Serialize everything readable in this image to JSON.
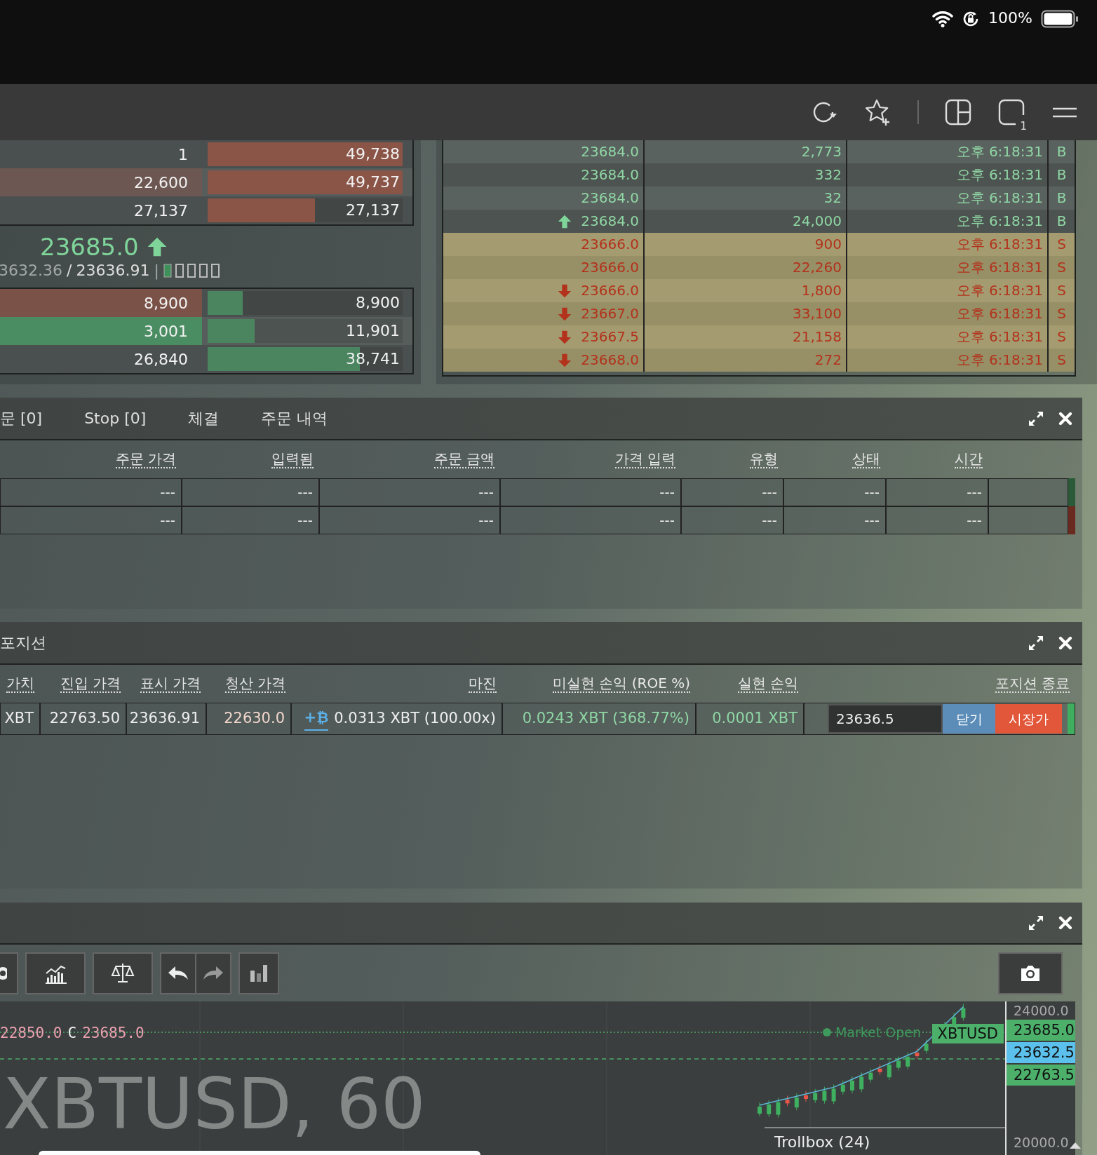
{
  "status_bar": {
    "battery": "100%"
  },
  "browser_toolbar": {
    "tab_count": "1"
  },
  "order_book": {
    "asks": [
      {
        "size": "1",
        "total": "49,738",
        "color": "#4a504f",
        "level": 1
      },
      {
        "size": "22,600",
        "total": "49,737",
        "color": "#6c5753",
        "level": 1
      },
      {
        "size": "27,137",
        "total": "27,137",
        "color": "#4a504f",
        "level": 0.55
      }
    ],
    "last_price": "23685.0",
    "price_rising": true,
    "index_price": "3632.36",
    "separator": "/",
    "mark_price": "23636.91",
    "divider": "|",
    "bids": [
      {
        "size": "8,900",
        "total": "8,900",
        "color": "#7b5248",
        "level": 0.18
      },
      {
        "size": "3,001",
        "total": "11,901",
        "color": "#4b8d63",
        "level": 0.24
      },
      {
        "size": "26,840",
        "total": "38,741",
        "color": "#4a504f",
        "level": 0.78
      }
    ]
  },
  "trades": {
    "rows": [
      {
        "arrow": false,
        "price": "23684.0",
        "size": "2,773",
        "time": "오후 6:18:31",
        "side": "B",
        "kind": "buy"
      },
      {
        "arrow": false,
        "price": "23684.0",
        "size": "332",
        "time": "오후 6:18:31",
        "side": "B",
        "kind": "buy"
      },
      {
        "arrow": false,
        "price": "23684.0",
        "size": "32",
        "time": "오후 6:18:31",
        "side": "B",
        "kind": "buy"
      },
      {
        "arrow": true,
        "price": "23684.0",
        "size": "24,000",
        "time": "오후 6:18:31",
        "side": "B",
        "kind": "buy"
      },
      {
        "arrow": false,
        "price": "23666.0",
        "size": "900",
        "time": "오후 6:18:31",
        "side": "S",
        "kind": "sell"
      },
      {
        "arrow": false,
        "price": "23666.0",
        "size": "22,260",
        "time": "오후 6:18:31",
        "side": "S",
        "kind": "sell"
      },
      {
        "arrow": true,
        "price": "23666.0",
        "size": "1,800",
        "time": "오후 6:18:31",
        "side": "S",
        "kind": "sell"
      },
      {
        "arrow": true,
        "price": "23667.0",
        "size": "33,100",
        "time": "오후 6:18:31",
        "side": "S",
        "kind": "sell"
      },
      {
        "arrow": true,
        "price": "23667.5",
        "size": "21,158",
        "time": "오후 6:18:31",
        "side": "S",
        "kind": "sell"
      },
      {
        "arrow": true,
        "price": "23668.0",
        "size": "272",
        "time": "오후 6:18:31",
        "side": "S",
        "kind": "sell"
      }
    ]
  },
  "orders": {
    "tabs": [
      {
        "label": "문 [0]"
      },
      {
        "label": "Stop [0]"
      },
      {
        "label": "체결"
      },
      {
        "label": "주문 내역"
      }
    ],
    "columns": [
      "주문 가격",
      "입력됨",
      "주문 금액",
      "가격 입력",
      "유형",
      "상태",
      "시간"
    ],
    "rows": [
      {
        "cells": [
          "---",
          "---",
          "---",
          "---",
          "---",
          "---",
          "---"
        ],
        "color": "#2b5a38"
      },
      {
        "cells": [
          "---",
          "---",
          "---",
          "---",
          "---",
          "---",
          "---"
        ],
        "color": "#6b2a1f"
      }
    ]
  },
  "positions": {
    "title": "포지션",
    "columns": [
      "가치",
      "진입 가격",
      "표시 가격",
      "청산 가격",
      "마진",
      "미실현 손익 (ROE %)",
      "실현 손익",
      "포지션 종료"
    ],
    "rows": [
      {
        "value": "XBT",
        "entry_price": "22763.50",
        "mark_price": "23636.91",
        "liq_price": "22630.0",
        "margin_add": "+₿",
        "margin": "0.0313 XBT (100.00x)",
        "unrealised_pnl": "0.0243 XBT (368.77%)",
        "realised_pnl": "0.0001 XBT",
        "close_price": "23636.5",
        "close_button": "닫기",
        "market_button": "시장가",
        "color": "#3fae5f"
      }
    ]
  },
  "chart": {
    "legend": [
      {
        "text": "22850.0",
        "kind": "value"
      },
      {
        "text": "C",
        "kind": "key"
      },
      {
        "text": "23685.0",
        "kind": "value"
      }
    ],
    "symbol_caption": "XBTUSD, 60",
    "market_status": "Market Open",
    "symbol_tag": "XBTUSD",
    "price_tags": [
      {
        "text": "23685.0",
        "color": "#4caf6a"
      },
      {
        "text": "23632.5",
        "color": "#5bc0eb"
      },
      {
        "text": "22763.5",
        "color": "#4caf6a"
      }
    ],
    "axis_labels": [
      "24000.0",
      "20000.0"
    ],
    "trollbox": "Trollbox (24)"
  }
}
